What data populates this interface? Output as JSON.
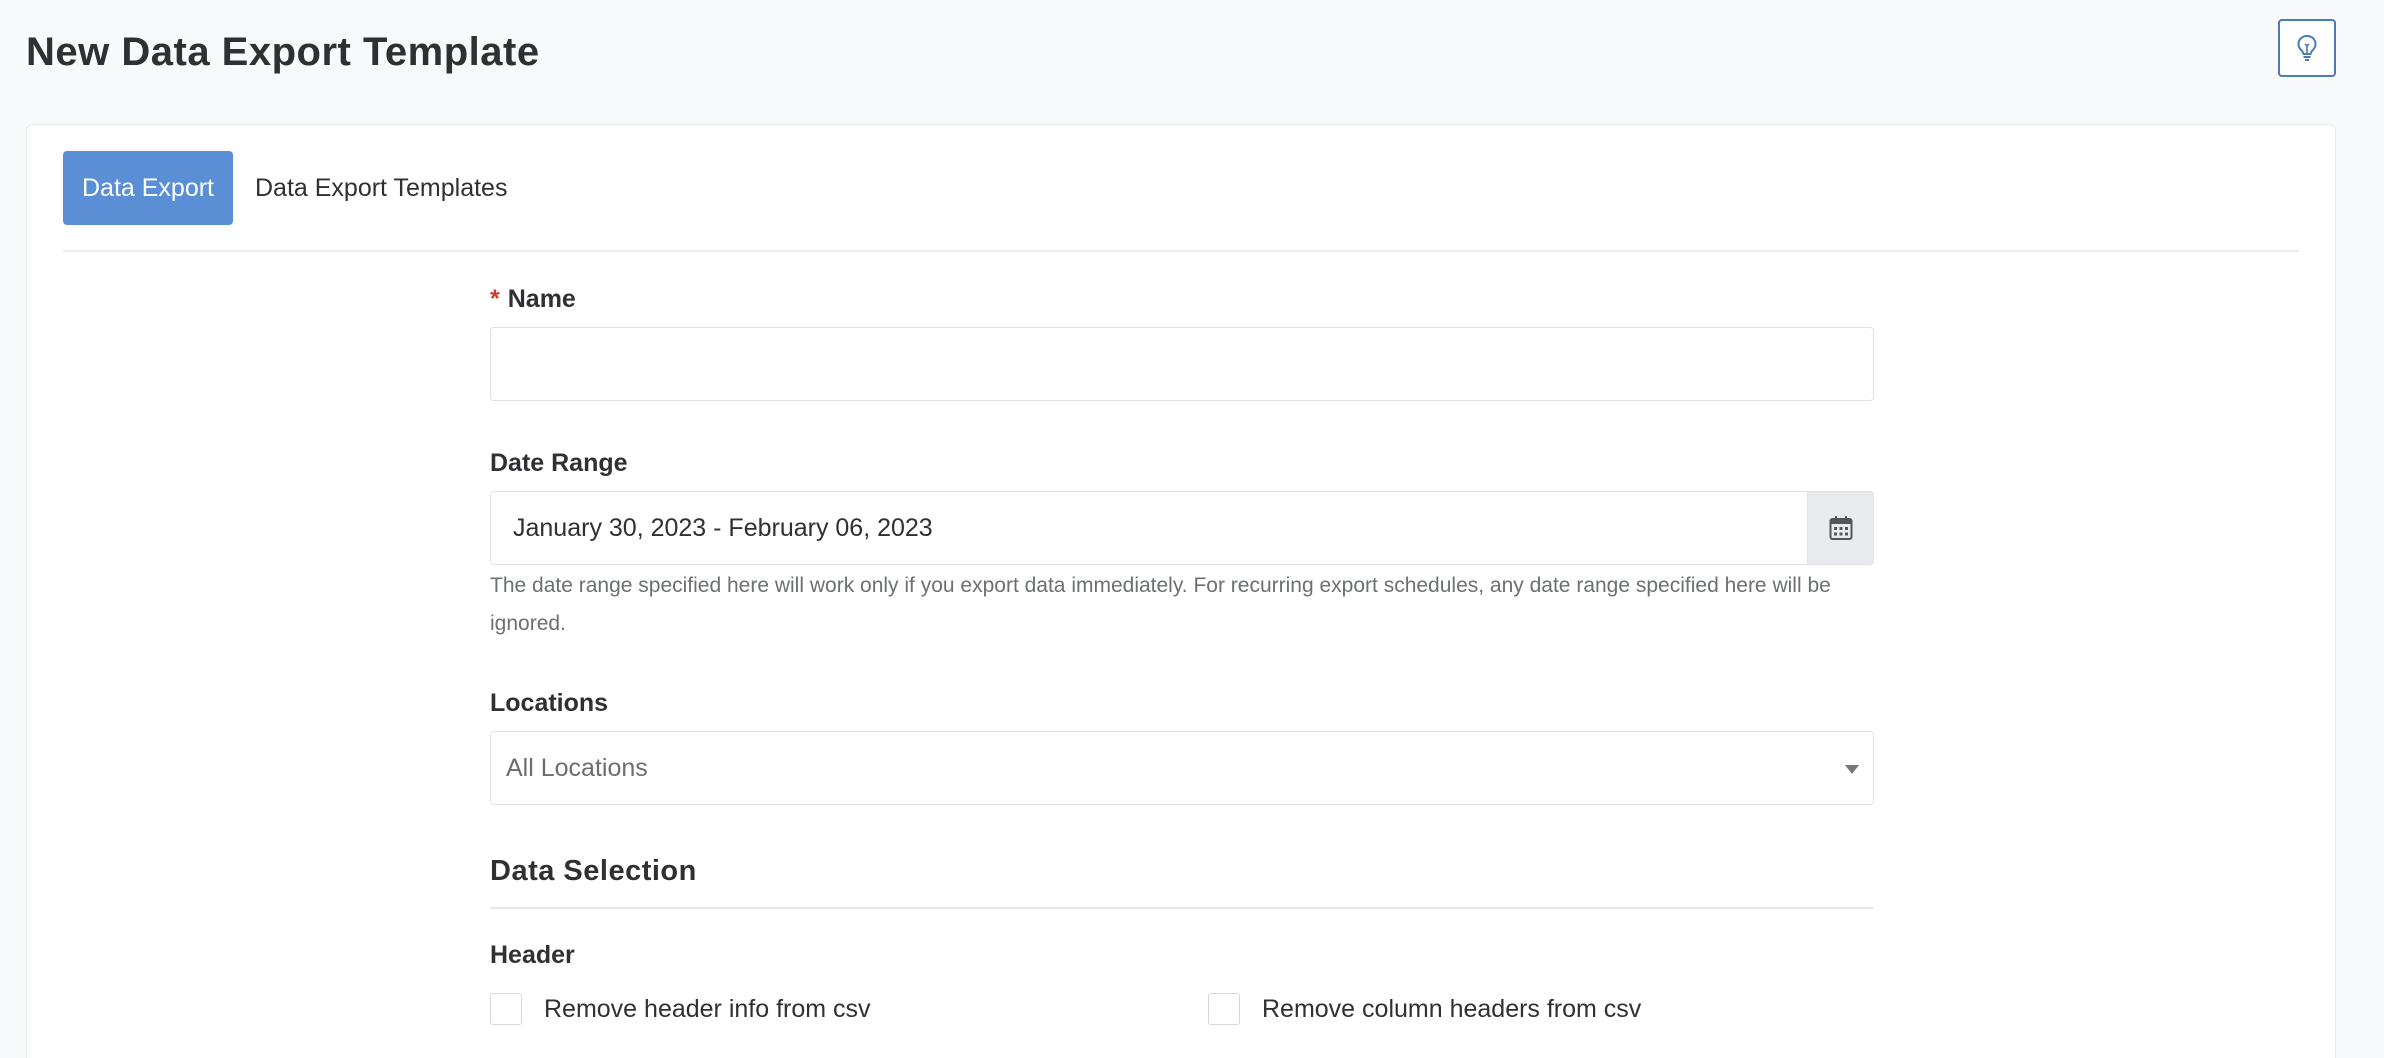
{
  "page": {
    "title": "New Data Export Template"
  },
  "help_button": {
    "icon": "lightbulb-icon"
  },
  "tabs": [
    {
      "label": "Data Export",
      "active": true
    },
    {
      "label": "Data Export Templates",
      "active": false
    }
  ],
  "form": {
    "name": {
      "required_marker": "*",
      "label": "Name",
      "value": "",
      "placeholder": ""
    },
    "date_range": {
      "label": "Date Range",
      "value": "January 30, 2023 - February 06, 2023",
      "icon": "calendar-icon",
      "help": "The date range specified here will work only if you export data immediately. For recurring export schedules, any date range specified here will be ignored."
    },
    "locations": {
      "label": "Locations",
      "selected": "All Locations"
    },
    "data_selection": {
      "title": "Data Selection",
      "header": {
        "label": "Header",
        "options": [
          {
            "label": "Remove header info from csv",
            "checked": false
          },
          {
            "label": "Remove column headers from csv",
            "checked": false
          }
        ]
      }
    }
  },
  "colors": {
    "accent": "#5a8fd6",
    "required": "#d13b2f",
    "outline": "#4b7bb5"
  }
}
